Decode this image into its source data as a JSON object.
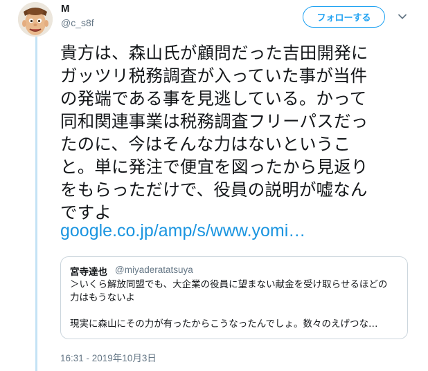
{
  "author": {
    "display_name": "M",
    "handle": "@c_s8f",
    "avatar_icon": "cartoon-cowboy-avatar"
  },
  "header": {
    "follow_label": "フォローする",
    "more_icon": "chevron-down-icon"
  },
  "tweet": {
    "text": "貴方は、森山氏が顧問だった吉田開発に\nガッツリ税務調査が入っていた事が当件\nの発端である事を見逃している。かって\n同和関連事業は税務調査フリーパスだっ\nたのに、今はそんな力はないというこ\nと。単に発注で便宜を図ったから見返り\nをもらっただけで、役員の説明が嘘なん\nですよ",
    "link": "google.co.jp/amp/s/www.yomi…"
  },
  "quote": {
    "author_name": "宮寺達也",
    "author_handle": "@miyaderatatsuya",
    "line1": "＞いくら解放同盟でも、大企業の役員に望まない献金を受け取らせるほどの",
    "line2": "力はもうないよ",
    "line3": "現実に森山にその力が有ったからこうなったんでしょ。数々のえげつな…"
  },
  "timestamp": "16:31 - 2019年10月3日",
  "colors": {
    "accent": "#1da1f2",
    "link": "#1b95e0",
    "thread_line": "#c4e2f5",
    "secondary_text": "#657786",
    "border": "#ccd6dd"
  }
}
